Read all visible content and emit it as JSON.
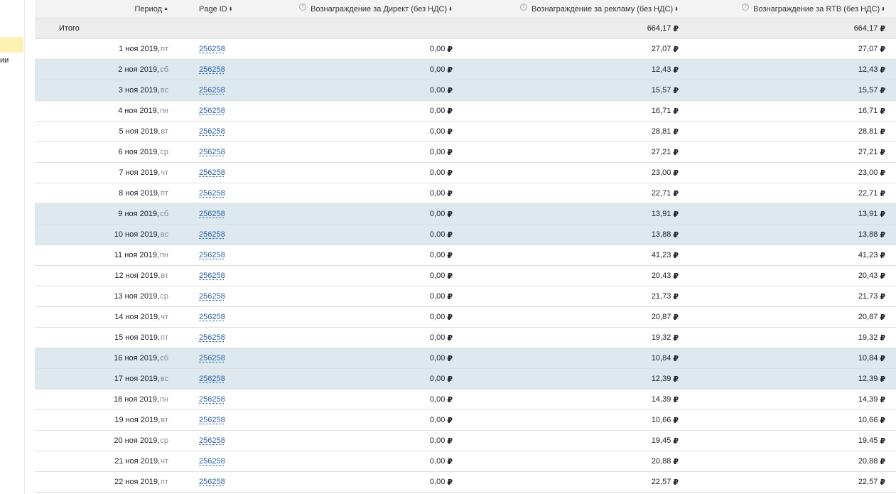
{
  "sidebar": {
    "label_fragment": "ии"
  },
  "header": {
    "period": "Период",
    "period_sort": "▲",
    "page_id": "Page ID",
    "direct": "Вознаграждение за Директ (без НДС)",
    "ads": "Вознаграждение за рекламу (без НДС)",
    "rtb": "Вознаграждение за RTB (без НДС)",
    "sort_glyph": "⬍",
    "help_glyph": "?"
  },
  "total": {
    "label": "Итого",
    "ads": "664,17",
    "rtb": "664,17"
  },
  "currency": "₽",
  "rows": [
    {
      "date": "1 ноя 2019,",
      "dow": "пт",
      "page_id": "256258",
      "direct": "0,00",
      "ads": "27,07",
      "rtb": "27,07",
      "weekend": false
    },
    {
      "date": "2 ноя 2019,",
      "dow": "сб",
      "page_id": "256258",
      "direct": "0,00",
      "ads": "12,43",
      "rtb": "12,43",
      "weekend": true
    },
    {
      "date": "3 ноя 2019,",
      "dow": "вс",
      "page_id": "256258",
      "direct": "0,00",
      "ads": "15,57",
      "rtb": "15,57",
      "weekend": true
    },
    {
      "date": "4 ноя 2019,",
      "dow": "пн",
      "page_id": "256258",
      "direct": "0,00",
      "ads": "16,71",
      "rtb": "16,71",
      "weekend": false
    },
    {
      "date": "5 ноя 2019,",
      "dow": "вт",
      "page_id": "256258",
      "direct": "0,00",
      "ads": "28,81",
      "rtb": "28,81",
      "weekend": false
    },
    {
      "date": "6 ноя 2019,",
      "dow": "ср",
      "page_id": "256258",
      "direct": "0,00",
      "ads": "27,21",
      "rtb": "27,21",
      "weekend": false
    },
    {
      "date": "7 ноя 2019,",
      "dow": "чт",
      "page_id": "256258",
      "direct": "0,00",
      "ads": "23,00",
      "rtb": "23,00",
      "weekend": false
    },
    {
      "date": "8 ноя 2019,",
      "dow": "пт",
      "page_id": "256258",
      "direct": "0,00",
      "ads": "22,71",
      "rtb": "22,71",
      "weekend": false
    },
    {
      "date": "9 ноя 2019,",
      "dow": "сб",
      "page_id": "256258",
      "direct": "0,00",
      "ads": "13,91",
      "rtb": "13,91",
      "weekend": true
    },
    {
      "date": "10 ноя 2019,",
      "dow": "вс",
      "page_id": "256258",
      "direct": "0,00",
      "ads": "13,88",
      "rtb": "13,88",
      "weekend": true
    },
    {
      "date": "11 ноя 2019,",
      "dow": "пн",
      "page_id": "256258",
      "direct": "0,00",
      "ads": "41,23",
      "rtb": "41,23",
      "weekend": false
    },
    {
      "date": "12 ноя 2019,",
      "dow": "вт",
      "page_id": "256258",
      "direct": "0,00",
      "ads": "20,43",
      "rtb": "20,43",
      "weekend": false
    },
    {
      "date": "13 ноя 2019,",
      "dow": "ср",
      "page_id": "256258",
      "direct": "0,00",
      "ads": "21,73",
      "rtb": "21,73",
      "weekend": false
    },
    {
      "date": "14 ноя 2019,",
      "dow": "чт",
      "page_id": "256258",
      "direct": "0,00",
      "ads": "20,87",
      "rtb": "20,87",
      "weekend": false
    },
    {
      "date": "15 ноя 2019,",
      "dow": "пт",
      "page_id": "256258",
      "direct": "0,00",
      "ads": "19,32",
      "rtb": "19,32",
      "weekend": false
    },
    {
      "date": "16 ноя 2019,",
      "dow": "сб",
      "page_id": "256258",
      "direct": "0,00",
      "ads": "10,84",
      "rtb": "10,84",
      "weekend": true
    },
    {
      "date": "17 ноя 2019,",
      "dow": "вс",
      "page_id": "256258",
      "direct": "0,00",
      "ads": "12,39",
      "rtb": "12,39",
      "weekend": true
    },
    {
      "date": "18 ноя 2019,",
      "dow": "пн",
      "page_id": "256258",
      "direct": "0,00",
      "ads": "14,39",
      "rtb": "14,39",
      "weekend": false
    },
    {
      "date": "19 ноя 2019,",
      "dow": "вт",
      "page_id": "256258",
      "direct": "0,00",
      "ads": "10,66",
      "rtb": "10,66",
      "weekend": false
    },
    {
      "date": "20 ноя 2019,",
      "dow": "ср",
      "page_id": "256258",
      "direct": "0,00",
      "ads": "19,45",
      "rtb": "19,45",
      "weekend": false
    },
    {
      "date": "21 ноя 2019,",
      "dow": "чт",
      "page_id": "256258",
      "direct": "0,00",
      "ads": "20,88",
      "rtb": "20,88",
      "weekend": false
    },
    {
      "date": "22 ноя 2019,",
      "dow": "пт",
      "page_id": "256258",
      "direct": "0,00",
      "ads": "22,57",
      "rtb": "22,57",
      "weekend": false
    }
  ],
  "colors": {
    "weekend_row": "#dde9ee",
    "total_row": "#ededed",
    "link": "#2b5ea7",
    "sidebar_highlight": "#fff1b3"
  }
}
